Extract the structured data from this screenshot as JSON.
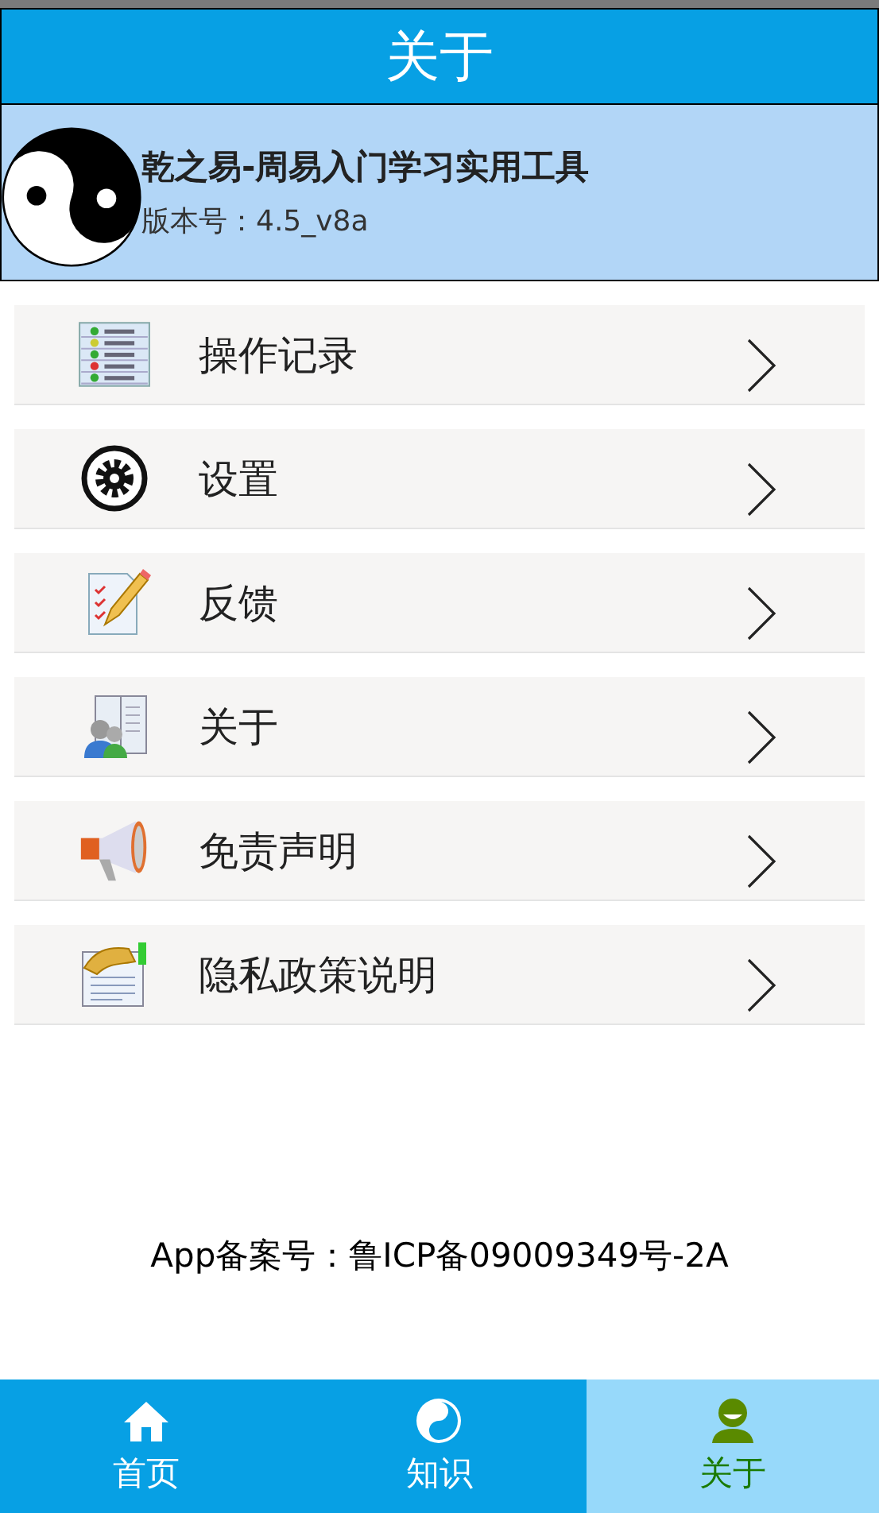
{
  "header": {
    "title": "关于"
  },
  "app": {
    "name": "乾之易-周易入门学习实用工具",
    "version": "版本号：4.5_v8a"
  },
  "menu": [
    {
      "label": "操作记录"
    },
    {
      "label": "设置"
    },
    {
      "label": "反馈"
    },
    {
      "label": "关于"
    },
    {
      "label": "免责声明"
    },
    {
      "label": "隐私政策说明"
    }
  ],
  "footer": {
    "text": "App备案号：鲁ICP备09009349号-2A"
  },
  "tabs": [
    {
      "label": "首页",
      "selected": false
    },
    {
      "label": "知识",
      "selected": false
    },
    {
      "label": "关于",
      "selected": true
    }
  ]
}
